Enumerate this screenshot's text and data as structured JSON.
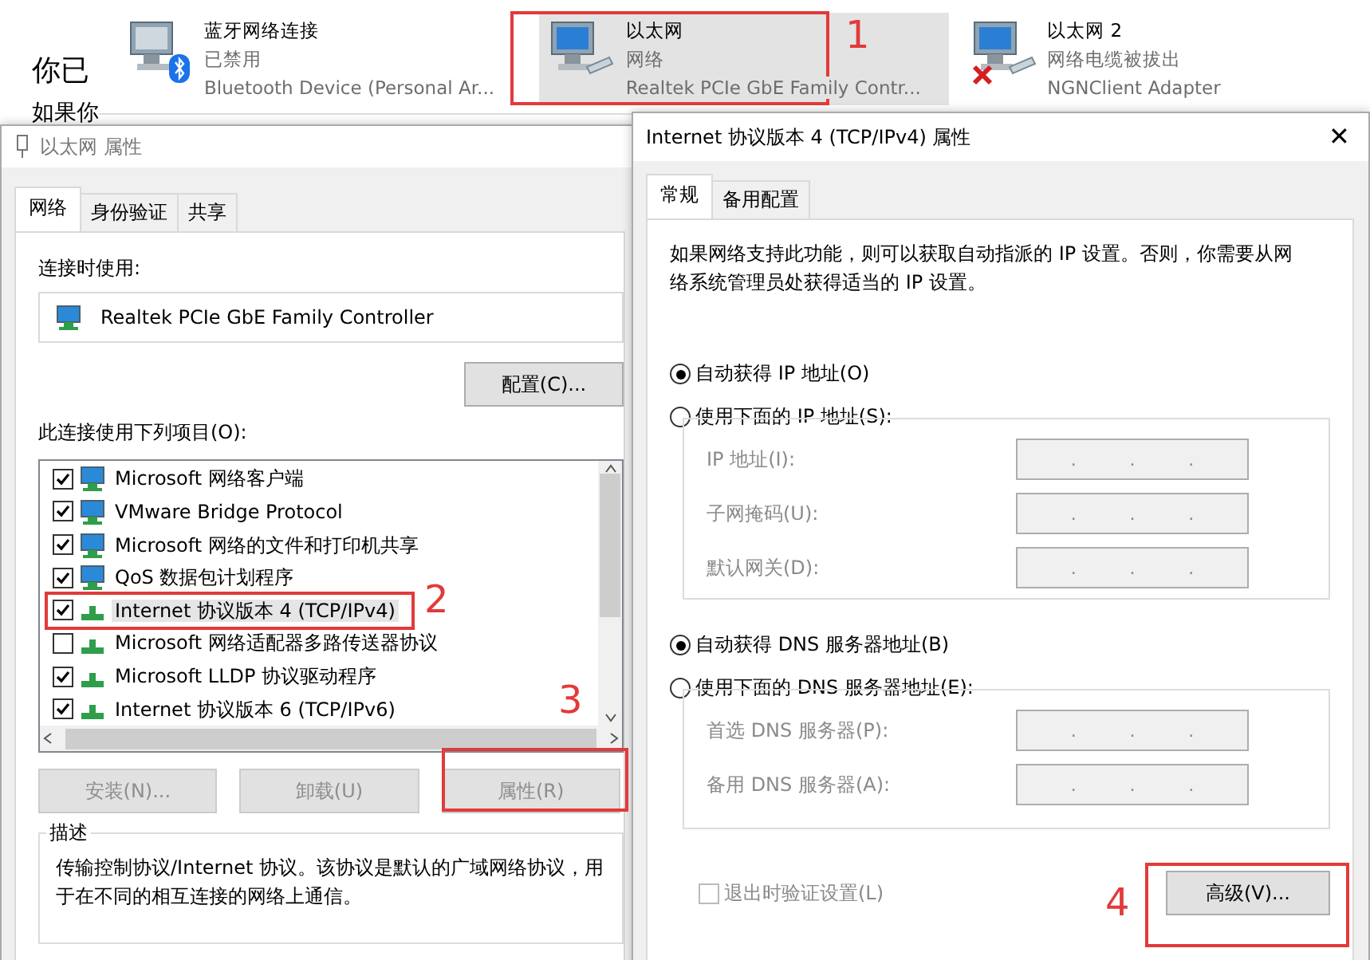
{
  "background_window": {
    "heading": "你已",
    "line": "如果你"
  },
  "connections": [
    {
      "kind": "bluetooth",
      "name": "蓝牙网络连接",
      "status": "已禁用",
      "device": "Bluetooth Device (Personal Ar...",
      "selected": false
    },
    {
      "kind": "ethernet",
      "name": "以太网",
      "status": "网络",
      "device": "Realtek PCIe GbE Family Contr...",
      "selected": true
    },
    {
      "kind": "unplugged",
      "name": "以太网 2",
      "status": "网络电缆被拔出",
      "device": "NGNClient Adapter",
      "selected": false
    }
  ],
  "adapter_properties": {
    "title": "以太网 属性",
    "tabs": [
      {
        "label": "网络",
        "selected": true
      },
      {
        "label": "身份验证",
        "selected": false
      },
      {
        "label": "共享",
        "selected": false
      }
    ],
    "connect_using_label": "连接时使用:",
    "adapter": "Realtek PCIe GbE Family Controller",
    "configure_button": "配置(C)...",
    "items_label": "此连接使用下列项目(O):",
    "items": [
      {
        "kind": "client",
        "label": "Microsoft 网络客户端",
        "checked": true,
        "selected": false
      },
      {
        "kind": "client",
        "label": "VMware Bridge Protocol",
        "checked": true,
        "selected": false
      },
      {
        "kind": "client",
        "label": "Microsoft 网络的文件和打印机共享",
        "checked": true,
        "selected": false
      },
      {
        "kind": "client",
        "label": "QoS 数据包计划程序",
        "checked": true,
        "selected": false
      },
      {
        "kind": "protocol",
        "label": "Internet 协议版本 4 (TCP/IPv4)",
        "checked": true,
        "selected": true
      },
      {
        "kind": "protocol",
        "label": "Microsoft 网络适配器多路传送器协议",
        "checked": false,
        "selected": false
      },
      {
        "kind": "protocol",
        "label": "Microsoft LLDP 协议驱动程序",
        "checked": true,
        "selected": false
      },
      {
        "kind": "protocol",
        "label": "Internet 协议版本 6 (TCP/IPv6)",
        "checked": true,
        "selected": false
      }
    ],
    "buttons": [
      {
        "label": "安装(N)...",
        "disabled": true
      },
      {
        "label": "卸载(U)",
        "disabled": true
      },
      {
        "label": "属性(R)",
        "disabled": true
      }
    ],
    "description_title": "描述",
    "description": "传输控制协议/Internet 协议。该协议是默认的广域网络协议，用于在不同的相互连接的网络上通信。"
  },
  "ipv4_properties": {
    "title": "Internet 协议版本 4 (TCP/IPv4) 属性",
    "close": "✕",
    "tabs": [
      {
        "label": "常规",
        "selected": true
      },
      {
        "label": "备用配置",
        "selected": false
      }
    ],
    "intro": "如果网络支持此功能，则可以获取自动指派的 IP 设置。否则，你需要从网络系统管理员处获得适当的 IP 设置。",
    "ip_options": [
      {
        "label": "自动获得 IP 地址(O)",
        "selected": true
      },
      {
        "label": "使用下面的 IP 地址(S):",
        "selected": false
      }
    ],
    "ip_fields": [
      {
        "label": "IP 地址(I):",
        "dots": [
          ".",
          ".",
          "."
        ]
      },
      {
        "label": "子网掩码(U):",
        "dots": [
          ".",
          ".",
          "."
        ]
      },
      {
        "label": "默认网关(D):",
        "dots": [
          ".",
          ".",
          "."
        ]
      }
    ],
    "dns_options": [
      {
        "label": "自动获得 DNS 服务器地址(B)",
        "selected": true
      },
      {
        "label": "使用下面的 DNS 服务器地址(E):",
        "selected": false
      }
    ],
    "dns_fields": [
      {
        "label": "首选 DNS 服务器(P):",
        "dots": [
          ".",
          ".",
          "."
        ]
      },
      {
        "label": "备用 DNS 服务器(A):",
        "dots": [
          ".",
          ".",
          "."
        ]
      }
    ],
    "validate": {
      "label": "退出时验证设置(L)",
      "checked": false,
      "disabled": true
    },
    "advanced_button": "高级(V)..."
  },
  "annotations": [
    {
      "number": "1"
    },
    {
      "number": "2"
    },
    {
      "number": "3"
    },
    {
      "number": "4"
    }
  ]
}
